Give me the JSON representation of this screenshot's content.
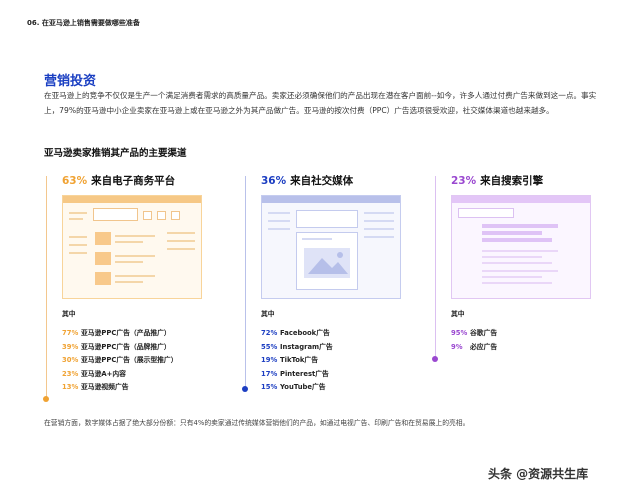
{
  "header": "06. 在亚马逊上销售需要做哪些准备",
  "section_title": "营销投资",
  "intro": "在亚马逊上的竞争不仅仅是生产一个满足消费者需求的高质量产品。卖家还必须确保他们的产品出现在潜在客户面前--如今，许多人通过付费广告来做到这一点。事实上，79%的亚马逊中小企业卖家在亚马逊上或在亚马逊之外为其产品做广告。亚马逊的按次付费（PPC）广告选项很受欢迎，社交媒体渠道也越来越多。",
  "subtitle": "亚马逊卖家推销其产品的主要渠道",
  "channels": [
    {
      "pct": "63%",
      "label": "来自电子商务平台",
      "list_title": "其中",
      "items": [
        {
          "pct": "77%",
          "text": "亚马逊PPC广告（产品推广）"
        },
        {
          "pct": "39%",
          "text": "亚马逊PPC广告（品牌推广）"
        },
        {
          "pct": "30%",
          "text": "亚马逊PPC广告（展示型推广）"
        },
        {
          "pct": "23%",
          "text": "亚马逊A+内容"
        },
        {
          "pct": "13%",
          "text": "亚马逊视频广告"
        }
      ]
    },
    {
      "pct": "36%",
      "label": "来自社交媒体",
      "list_title": "其中",
      "items": [
        {
          "pct": "72%",
          "text": "Facebook广告"
        },
        {
          "pct": "55%",
          "text": "Instagram广告"
        },
        {
          "pct": "19%",
          "text": "TikTok广告"
        },
        {
          "pct": "17%",
          "text": "Pinterest广告"
        },
        {
          "pct": "15%",
          "text": "YouTube广告"
        }
      ]
    },
    {
      "pct": "23%",
      "label": "来自搜索引擎",
      "list_title": "其中",
      "items": [
        {
          "pct": "95%",
          "text": "谷歌广告"
        },
        {
          "pct": "9%",
          "text": "必应广告"
        }
      ]
    }
  ],
  "colors": {
    "orange": "#f0a232",
    "blue": "#1c3ec2",
    "purple": "#9a48d0",
    "title_blue": "#1a3fc2"
  },
  "footnote": "在营销方面，数字媒体占据了绝大部分份额：只有4%的卖家通过传统媒体营销他们的产品，如通过电视广告、印刷广告和在贸易展上的亮相。",
  "watermark": "头条 @资源共生库"
}
